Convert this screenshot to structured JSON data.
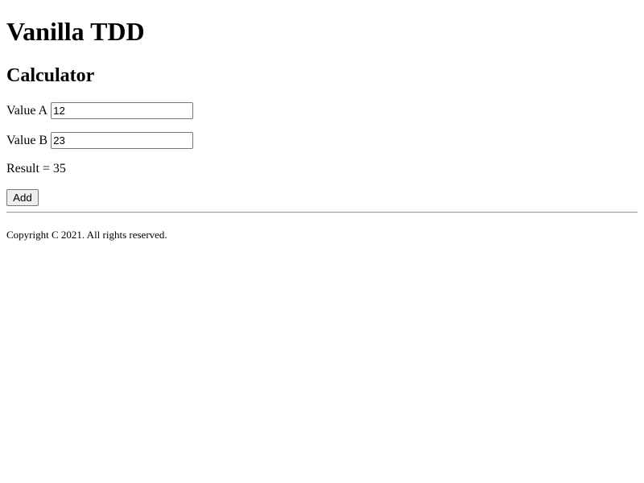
{
  "page": {
    "title": "Vanilla TDD",
    "subtitle": "Calculator"
  },
  "form": {
    "value_a_label": "Value A",
    "value_a": "12",
    "value_b_label": "Value B",
    "value_b": "23",
    "result_text": "Result = 35",
    "add_label": "Add"
  },
  "footer": {
    "copyright": "Copyright C 2021. All rights reserved."
  }
}
